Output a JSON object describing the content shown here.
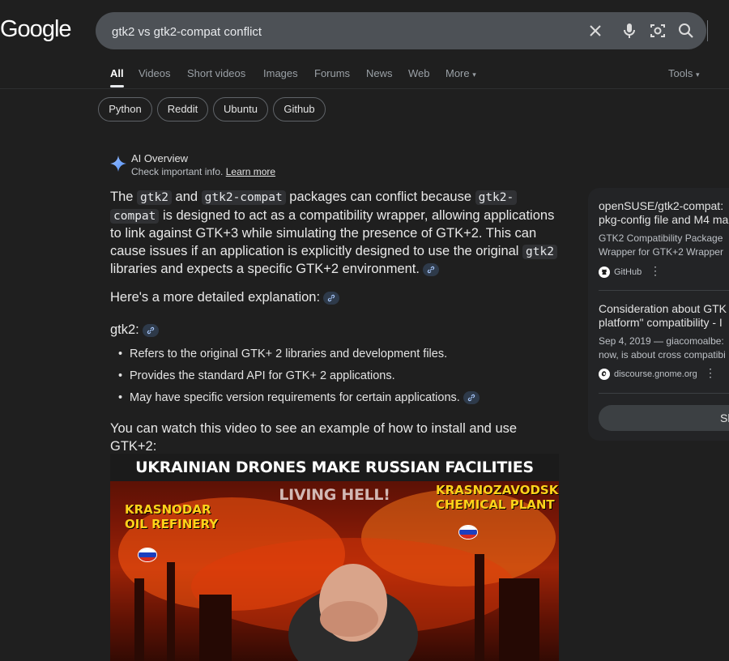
{
  "logo": "Google",
  "search": {
    "query": "gtk2 vs gtk2-compat conflict"
  },
  "tabs": [
    "All",
    "Videos",
    "Short videos",
    "Images",
    "Forums",
    "News",
    "Web",
    "More",
    "Tools"
  ],
  "chips": [
    "Python",
    "Reddit",
    "Ubuntu",
    "Github"
  ],
  "ai_overview": {
    "title": "AI Overview",
    "subtitle": "Check important info.",
    "learn_more": "Learn more",
    "p1": {
      "t1": "The ",
      "c1": "gtk2",
      "t2": " and ",
      "c2": "gtk2-compat",
      "t3": " packages can conflict because ",
      "c3a": "gtk2-",
      "c3b": "compat",
      "t4": " is designed to act as a compatibility wrapper, allowing applications to link against GTK+3 while simulating the presence of GTK+2. This can cause issues if an application is explicitly designed to use the original ",
      "c4": "gtk2",
      "t5": " libraries and expects a specific GTK+2 environment."
    },
    "explanation_intro": "Here's a more detailed explanation:",
    "gtk2_heading": "gtk2:",
    "bullets": [
      "Refers to the original GTK+ 2 libraries and development files.",
      "Provides the standard API for GTK+ 2 applications.",
      "May have specific version requirements for certain applications."
    ],
    "video_intro": "You can watch this video to see an example of how to install and use GTK+2:"
  },
  "video": {
    "headline": "UKRAINIAN DRONES MAKE RUSSIAN FACILITIES LIVING HELL!",
    "label_left_1": "KRASNODAR",
    "label_left_2": "OIL REFINERY",
    "label_right_1": "KRASNOZAVODSK",
    "label_right_2": "CHEMICAL PLANT"
  },
  "side_panel": {
    "cards": [
      {
        "title_1": "openSUSE/gtk2-compat:",
        "title_2": "pkg-config file and M4 ma",
        "desc_1": "GTK2 Compatibility Package",
        "desc_2": "Wrapper for GTK+2 Wrapper",
        "source": "GitHub"
      },
      {
        "title_1": "Consideration about GTK",
        "title_2": "platform\" compatibility - I",
        "desc_1": "Sep 4, 2019 — giacomoalbe:",
        "desc_2": "now, is about cross compatibi",
        "source": "discourse.gnome.org"
      }
    ],
    "show_all": "Sh"
  }
}
